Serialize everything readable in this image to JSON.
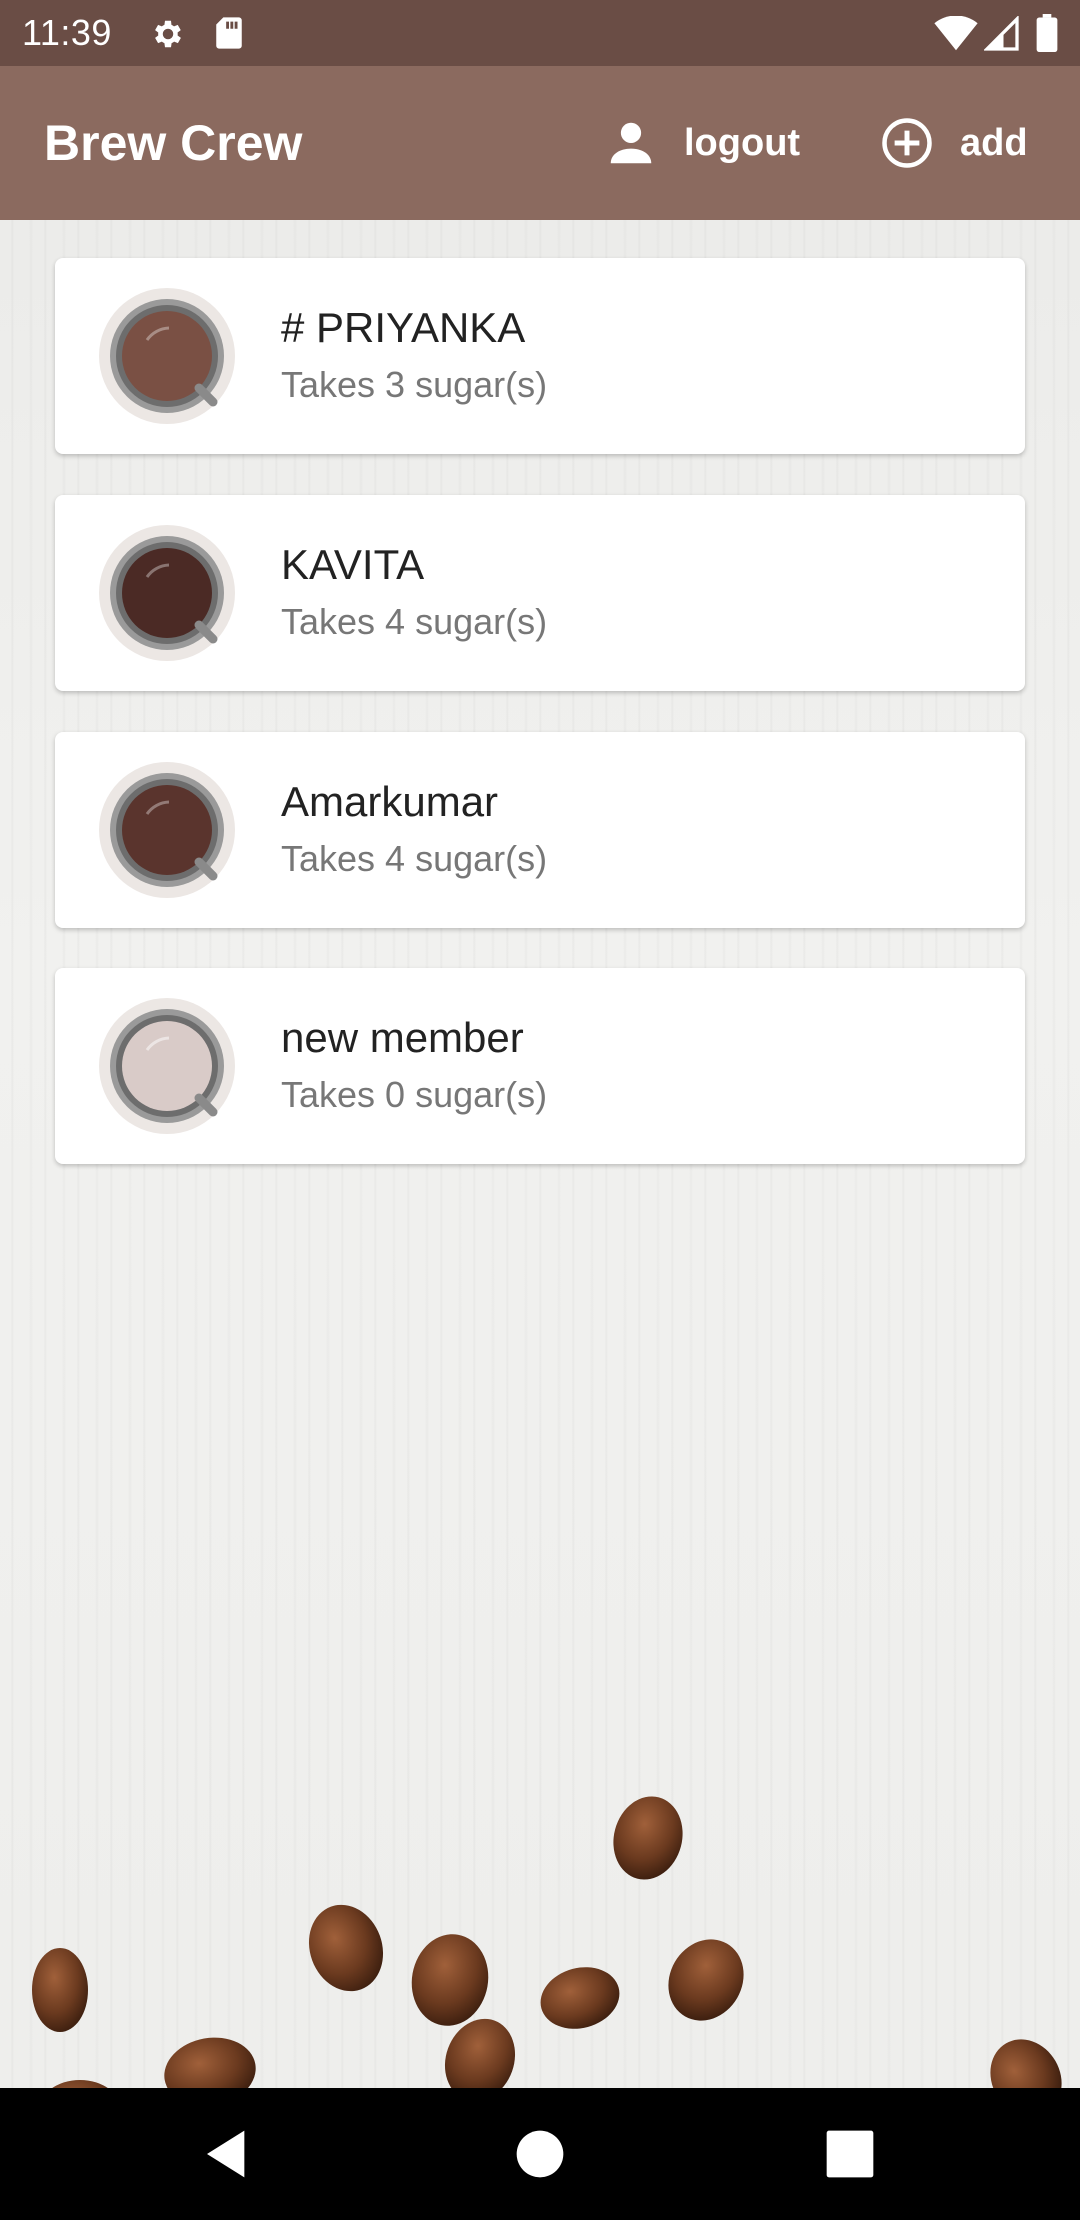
{
  "status_bar": {
    "time": "11:39",
    "icons": [
      "gear-icon",
      "sd-card-icon",
      "wifi-icon",
      "signal-icon",
      "battery-icon"
    ]
  },
  "app_bar": {
    "title": "Brew Crew",
    "logout_label": "logout",
    "add_label": "add",
    "background": "#8b6a5f"
  },
  "members": [
    {
      "name": "# PRIYANKA",
      "subtitle": "Takes 3 sugar(s)",
      "coffee_color": "#7a5044"
    },
    {
      "name": "KAVITA",
      "subtitle": "Takes 4 sugar(s)",
      "coffee_color": "#4b2a25"
    },
    {
      "name": "Amarkumar",
      "subtitle": "Takes 4 sugar(s)",
      "coffee_color": "#5a342d"
    },
    {
      "name": "new member",
      "subtitle": "Takes 0 sugar(s)",
      "coffee_color": "#d9cbc8"
    }
  ],
  "nav_bar": {
    "icons": [
      "back-icon",
      "home-icon",
      "recent-apps-icon"
    ]
  }
}
